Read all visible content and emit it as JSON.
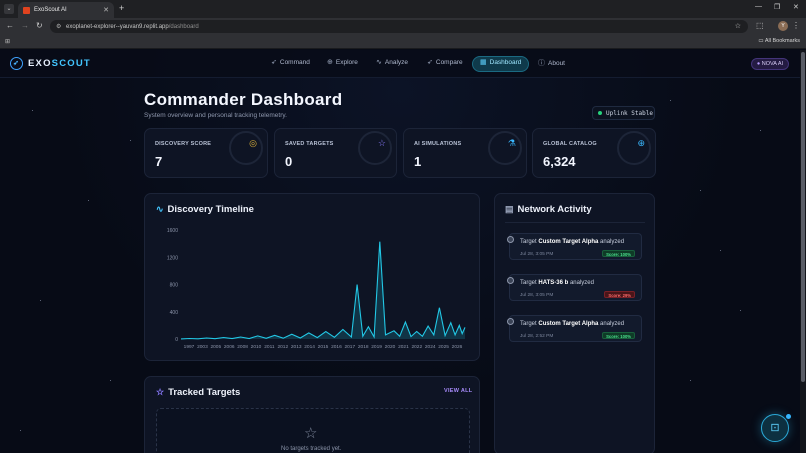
{
  "browser": {
    "tab_title": "ExoScout AI",
    "url_host": "exoplanet-explorer--yauvan9.replit.app",
    "url_path": "/dashboard",
    "bookmarks_label": "All Bookmarks",
    "profile_initial": "Y"
  },
  "nav": {
    "logo_a": "EXO",
    "logo_b": "SCOUT",
    "items": [
      {
        "label": "Command",
        "icon": "rocket-icon"
      },
      {
        "label": "Explore",
        "icon": "globe-icon"
      },
      {
        "label": "Analyze",
        "icon": "pulse-icon"
      },
      {
        "label": "Compare",
        "icon": "rocket-icon"
      },
      {
        "label": "Dashboard",
        "icon": "dashboard-icon"
      },
      {
        "label": "About",
        "icon": "info-icon"
      }
    ],
    "active": "Dashboard",
    "nova_label": "NOVA AI"
  },
  "header": {
    "title": "Commander Dashboard",
    "subtitle": "System overview and personal tracking telemetry.",
    "uplink": "Uplink Stable"
  },
  "stats": [
    {
      "label": "DISCOVERY SCORE",
      "value": "7",
      "icon": "target-icon",
      "color": "#e0b43a"
    },
    {
      "label": "SAVED TARGETS",
      "value": "0",
      "icon": "star-icon",
      "color": "#8b7bff"
    },
    {
      "label": "AI SIMULATIONS",
      "value": "1",
      "icon": "flask-icon",
      "color": "#3ab8ff"
    },
    {
      "label": "GLOBAL CATALOG",
      "value": "6,324",
      "icon": "globe-icon",
      "color": "#3ab8ff"
    }
  ],
  "timeline": {
    "title": "Discovery Timeline"
  },
  "chart_data": {
    "type": "line",
    "title": "Discovery Timeline",
    "ylim": [
      0,
      1600
    ],
    "y_ticks": [
      0,
      400,
      800,
      1200,
      1600
    ],
    "x_ticks": [
      "1997",
      "2003",
      "2005",
      "2006",
      "2008",
      "2010",
      "2011",
      "2012",
      "2013",
      "2014",
      "2015",
      "2016",
      "2017",
      "2018",
      "2019",
      "2020",
      "2021",
      "2022",
      "2024",
      "2025",
      "2026"
    ],
    "series": [
      {
        "color": "#22c8e6",
        "points": [
          [
            0,
            2
          ],
          [
            0.03,
            8
          ],
          [
            0.06,
            3
          ],
          [
            0.09,
            15
          ],
          [
            0.12,
            5
          ],
          [
            0.15,
            22
          ],
          [
            0.18,
            6
          ],
          [
            0.21,
            30
          ],
          [
            0.24,
            8
          ],
          [
            0.27,
            45
          ],
          [
            0.3,
            10
          ],
          [
            0.33,
            55
          ],
          [
            0.36,
            12
          ],
          [
            0.39,
            70
          ],
          [
            0.42,
            15
          ],
          [
            0.45,
            90
          ],
          [
            0.48,
            20
          ],
          [
            0.51,
            110
          ],
          [
            0.54,
            25
          ],
          [
            0.57,
            140
          ],
          [
            0.6,
            30
          ],
          [
            0.62,
            800
          ],
          [
            0.64,
            40
          ],
          [
            0.66,
            180
          ],
          [
            0.68,
            30
          ],
          [
            0.7,
            1430
          ],
          [
            0.72,
            60
          ],
          [
            0.75,
            120
          ],
          [
            0.77,
            40
          ],
          [
            0.79,
            250
          ],
          [
            0.81,
            35
          ],
          [
            0.83,
            110
          ],
          [
            0.85,
            40
          ],
          [
            0.87,
            190
          ],
          [
            0.89,
            60
          ],
          [
            0.91,
            460
          ],
          [
            0.93,
            50
          ],
          [
            0.95,
            240
          ],
          [
            0.965,
            60
          ],
          [
            0.98,
            200
          ],
          [
            0.99,
            80
          ],
          [
            1.0,
            170
          ]
        ]
      }
    ]
  },
  "activity": {
    "title": "Network Activity",
    "items": [
      {
        "prefix": "Target",
        "target": "Custom Target Alpha",
        "suffix": "analyzed",
        "time": "Jul 28, 3:05 PM",
        "score": "Score: 100%",
        "status": "good"
      },
      {
        "prefix": "Target",
        "target": "HATS-36 b",
        "suffix": "analyzed",
        "time": "Jul 28, 3:05 PM",
        "score": "Score: 29%",
        "status": "bad"
      },
      {
        "prefix": "Target",
        "target": "Custom Target Alpha",
        "suffix": "analyzed",
        "time": "Jul 28, 2:52 PM",
        "score": "Score: 100%",
        "status": "good"
      }
    ]
  },
  "tracked": {
    "title": "Tracked Targets",
    "view_all": "VIEW ALL",
    "empty": "No targets tracked yet."
  }
}
